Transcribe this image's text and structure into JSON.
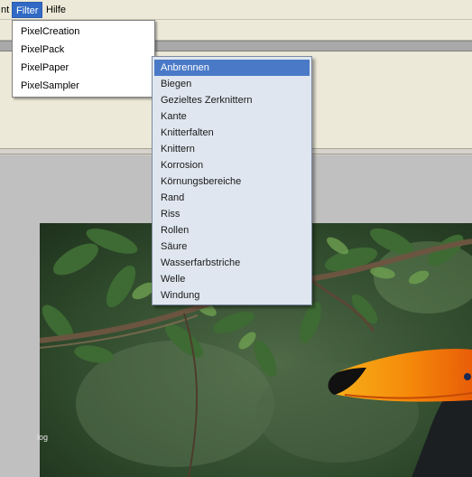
{
  "menubar": {
    "items": [
      {
        "label": "nt",
        "active": false
      },
      {
        "label": "Filter",
        "active": true
      },
      {
        "label": "Hilfe",
        "active": false
      }
    ]
  },
  "filter_menu": {
    "items": [
      {
        "label": "PixelCreation"
      },
      {
        "label": "PixelPack"
      },
      {
        "label": "PixelPaper"
      },
      {
        "label": "PixelSampler"
      }
    ]
  },
  "pixelpaper_submenu": {
    "highlighted_index": 0,
    "items": [
      {
        "label": "Anbrennen"
      },
      {
        "label": "Biegen"
      },
      {
        "label": "Gezieltes Zerknittern"
      },
      {
        "label": "Kante"
      },
      {
        "label": "Knitterfalten"
      },
      {
        "label": "Knittern"
      },
      {
        "label": "Korrosion"
      },
      {
        "label": "Körnungsbereiche"
      },
      {
        "label": "Rand"
      },
      {
        "label": "Riss"
      },
      {
        "label": "Rollen"
      },
      {
        "label": "Säure"
      },
      {
        "label": "Wasserfarbstriche"
      },
      {
        "label": "Welle"
      },
      {
        "label": "Windung"
      }
    ]
  },
  "canvas": {
    "edge_caption": "log",
    "colors": {
      "highlight": "#4a7ac7",
      "menu_active": "#316ac5",
      "toucan_bill": "#f59a0b"
    }
  }
}
